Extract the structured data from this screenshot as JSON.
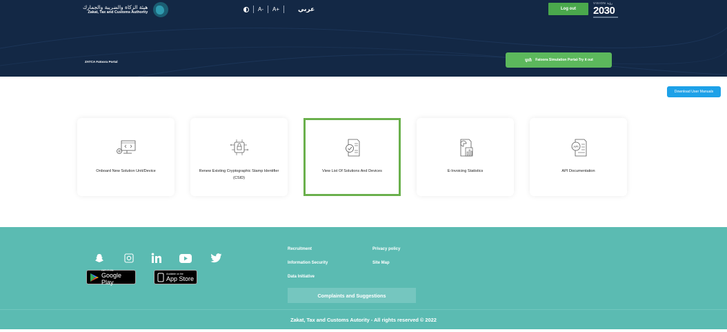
{
  "header": {
    "logo_ar": "هيئة الزكاة والضريبة والجمارك",
    "logo_en": "Zakat, Tax and Customs Authority",
    "font_decrease": "A-",
    "font_increase": "A+",
    "language": "عربي",
    "logout_label": "Log out",
    "vision_top": "VISION رؤية",
    "vision_number": "2030",
    "portal_title": "ZATCA Fatoora Portal",
    "simulation_label": "Fatoora Simulation Portal-Try it out"
  },
  "main": {
    "download_label": "Download User Manuals",
    "cards": [
      {
        "label": "Onboard New Solution Unit/Device",
        "icon": "computer-code-icon"
      },
      {
        "label": "Renew Existing Cryptographic Stamp Identifier (CSID)",
        "icon": "lock-chip-icon"
      },
      {
        "label": "View List Of Solutions And Devices",
        "icon": "checked-document-icon",
        "selected": true
      },
      {
        "label": "E-Invoicing Statistics",
        "icon": "statistics-document-icon"
      },
      {
        "label": "API Documentation",
        "icon": "api-document-icon"
      }
    ]
  },
  "footer": {
    "social": [
      "snapchat-icon",
      "instagram-icon",
      "linkedin-icon",
      "youtube-icon",
      "twitter-icon"
    ],
    "google_play_small": "GET IT ON",
    "google_play_big": "Google Play",
    "app_store_small": "Available on the",
    "app_store_big": "App Store",
    "links": {
      "recruitment": "Recruitment",
      "privacy": "Privacy policy",
      "info_security": "Information Security",
      "sitemap": "Site Map",
      "data_initiative": "Data Initiative"
    },
    "complaints_label": "Complaints and Suggestions",
    "copyright": "Zakat, Tax and Customs Autority - All rights reserved © 2022"
  },
  "colors": {
    "header_bg": "#132845",
    "accent_green": "#5cb85c",
    "download_blue": "#1da1e8",
    "footer_teal": "#5bbbb2",
    "selected_border": "#6ab04c"
  }
}
